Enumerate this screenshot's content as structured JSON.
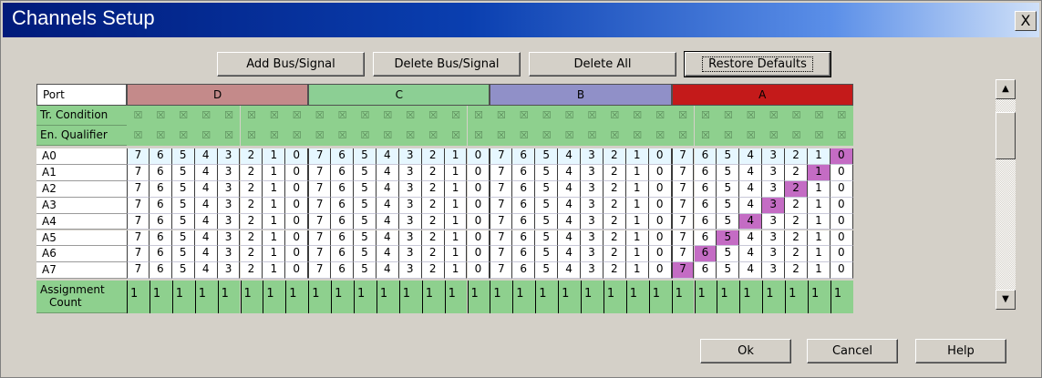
{
  "window": {
    "title": "Channels Setup",
    "close_label": "X"
  },
  "toolbar": {
    "add_label": "Add Bus/Signal",
    "delete_label": "Delete Bus/Signal",
    "delete_all_label": "Delete All",
    "restore_label": "Restore Defaults"
  },
  "grid": {
    "port_label": "Port",
    "tr_condition_label": "Tr. Condition",
    "en_qualifier_label": "En. Qualifier",
    "assignment_label_1": "Assignment",
    "assignment_label_2": "Count",
    "x_glyph": "☒",
    "ports": [
      {
        "name": "D",
        "color": "#c48a8a"
      },
      {
        "name": "C",
        "color": "#8ccf94"
      },
      {
        "name": "B",
        "color": "#9090c8"
      },
      {
        "name": "A",
        "color": "#c41a1a"
      }
    ],
    "bits": [
      "7",
      "6",
      "5",
      "4",
      "3",
      "2",
      "1",
      "0"
    ],
    "signals": [
      "A0",
      "A1",
      "A2",
      "A3",
      "A4",
      "A5",
      "A6",
      "A7"
    ],
    "assignment_count": "1"
  },
  "footer": {
    "ok_label": "Ok",
    "cancel_label": "Cancel",
    "help_label": "Help"
  },
  "scroll": {
    "up_icon": "▲",
    "down_icon": "▼"
  }
}
